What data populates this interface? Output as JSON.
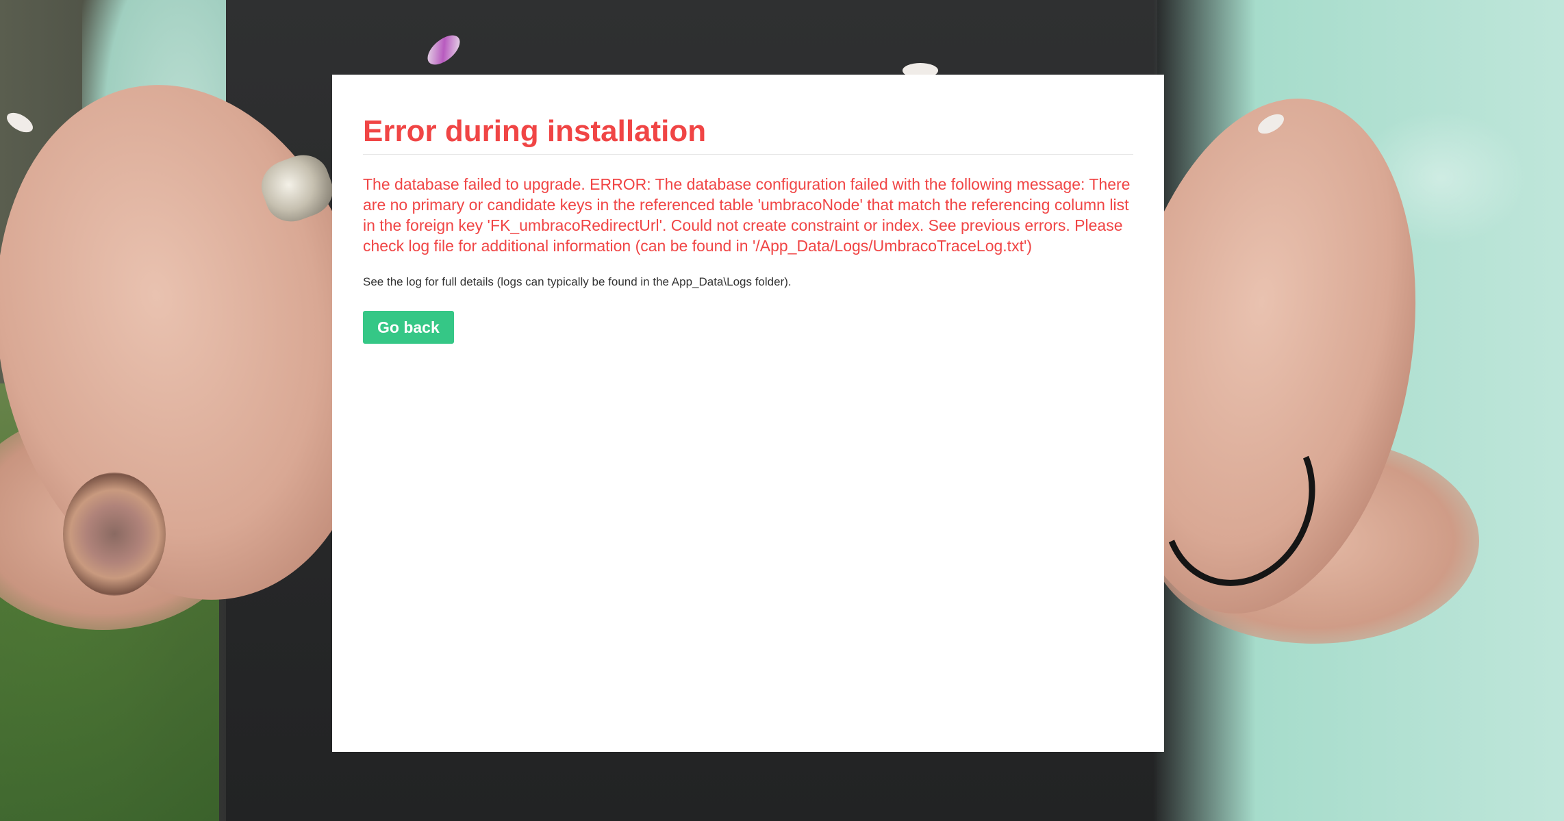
{
  "dialog": {
    "title": "Error during installation",
    "error_message": "The database failed to upgrade. ERROR: The database configuration failed with the following message: There are no primary or candidate keys in the referenced table 'umbracoNode' that match the referencing column list in the foreign key 'FK_umbracoRedirectUrl'. Could not create constraint or index. See previous errors. Please check log file for additional information (can be found in '/App_Data/Logs/UmbracoTraceLog.txt')",
    "log_hint": "See the log for full details (logs can typically be found in the App_Data\\Logs folder).",
    "go_back_label": "Go back"
  },
  "colors": {
    "error_red": "#f04545",
    "button_green": "#35c786",
    "panel_bg": "#ffffff"
  }
}
